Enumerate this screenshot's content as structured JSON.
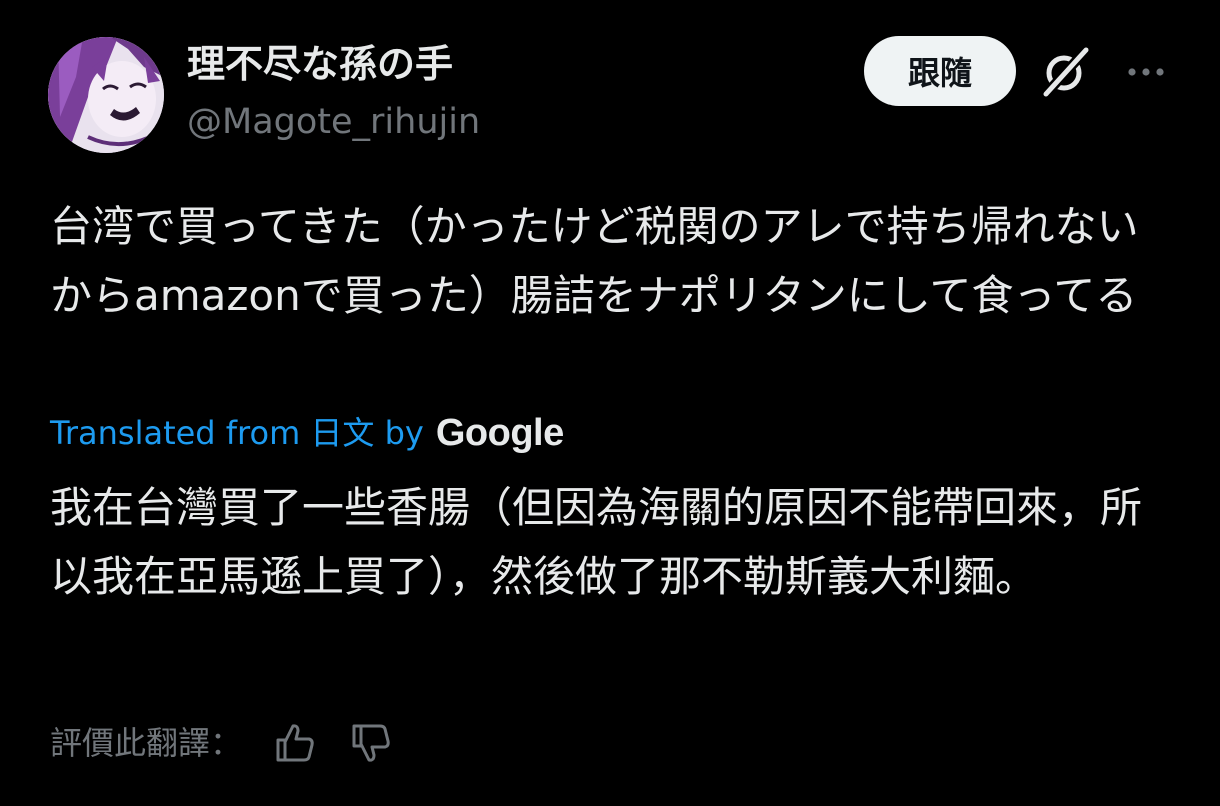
{
  "author": {
    "display_name": "理不尽な孫の手",
    "handle": "@Magote_rihujin",
    "avatar_icon": "avatar-image"
  },
  "actions": {
    "follow_label": "跟隨",
    "grok_icon": "grok-icon",
    "more_icon": "more-icon"
  },
  "post": {
    "original_text": "台湾で買ってきた（かったけど税関のアレで持ち帰れないからamazonで買った）腸詰をナポリタンにして食ってる",
    "translated_from": "Translated from 日文 by",
    "translation_provider": "Google",
    "translated_text": "我在台灣買了一些香腸（但因為海關的原因不能帶回來，所以我在亞馬遜上買了），然後做了那不勒斯義大利麵。"
  },
  "rating": {
    "label": "評價此翻譯：",
    "like_icon": "thumbs-up-icon",
    "dislike_icon": "thumbs-down-icon"
  },
  "colors": {
    "background": "#000000",
    "text": "#e7e9ea",
    "secondary": "#71767b",
    "link": "#1d9bf0",
    "button_bg": "#eff3f4"
  }
}
